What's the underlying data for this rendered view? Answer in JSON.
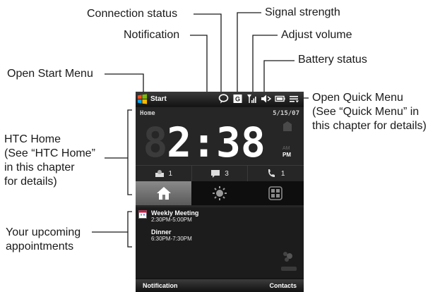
{
  "callouts": {
    "connection_status": "Connection status",
    "signal_strength": "Signal strength",
    "notification": "Notification",
    "adjust_volume": "Adjust volume",
    "battery_status": "Battery status",
    "open_start_menu": "Open Start Menu",
    "open_quick_menu": "Open Quick Menu\n(See “Quick Menu” in\nthis chapter for details)",
    "htc_home": "HTC Home\n(See “HTC Home”\nin this chapter\nfor details)",
    "upcoming_appointments": "Your upcoming\nappointments"
  },
  "phone": {
    "title_bar": {
      "start_label": "Start"
    },
    "home": {
      "label": "Home",
      "date": "5/15/07",
      "time": "2:38",
      "ampm": "PM",
      "counts": {
        "voicemail": "1",
        "messages": "3",
        "missed_calls": "1"
      }
    },
    "appointments": [
      {
        "title": "Weekly Meeting",
        "time": "2:30PM-5:00PM"
      },
      {
        "title": "Dinner",
        "time": "6:30PM-7:30PM"
      }
    ],
    "softkeys": {
      "left": "Notification",
      "right": "Contacts"
    }
  },
  "colors": {
    "screen_bg": "#161616",
    "clock_digits": "#ffffff",
    "tab_active": "#7a7a7a"
  }
}
